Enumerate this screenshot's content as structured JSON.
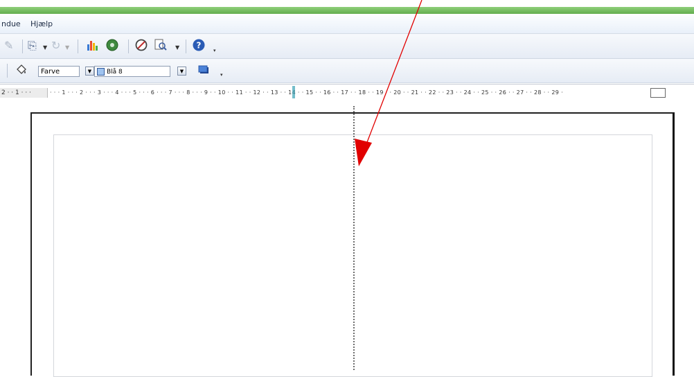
{
  "menubar": {
    "items": [
      "ndue",
      "Hjælp"
    ]
  },
  "toolbar2": {
    "fill_type": "Farve",
    "fill_color": "Blå 8"
  },
  "ruler": {
    "left_labels": "2 · · 1 · · ·",
    "right_labels": "· · · 1 · · · 2 · · · 3 · · · 4 · · · 5 · · · 6 · · · 7 · · · 8 · · · 9 · · 10 · · 11 · · 12 · · 13 · · 14 · · 15 · · 16 · · 17 · · 18 · · 19 · · 20 · · 21 · · 22 · · 23 · · 24 · · 25 · · 26 · · 27 · · 28 · · 29 ·"
  },
  "colors": {
    "title_green": "#62ad4e",
    "arrow_red": "#e10000",
    "fill_swatch": "#9fc3ef"
  },
  "icons": [
    "brush-icon",
    "copy-format-icon",
    "redo-icon",
    "chart-icon",
    "navigator-icon",
    "draw-functions-icon",
    "zoom-icon",
    "help-icon",
    "fill-bucket-icon",
    "shadow-icon"
  ]
}
